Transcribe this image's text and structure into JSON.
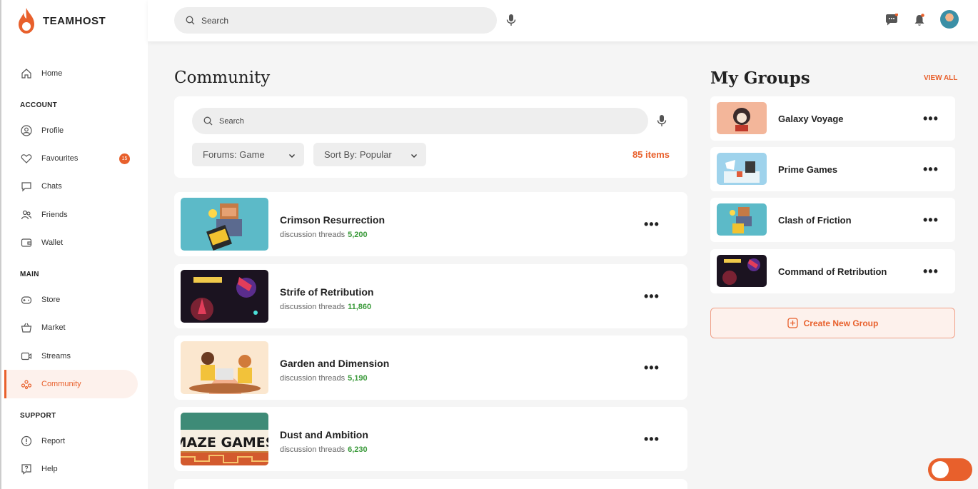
{
  "brand": {
    "name": "TEAMHOST",
    "accent": "#e8602c"
  },
  "search": {
    "placeholder": "Search"
  },
  "sidebar": {
    "home": "Home",
    "sections": {
      "account": "ACCOUNT",
      "main": "MAIN",
      "support": "SUPPORT"
    },
    "account_items": [
      {
        "label": "Profile",
        "icon": "user-icon"
      },
      {
        "label": "Favourites",
        "icon": "heart-icon",
        "badge": "15"
      },
      {
        "label": "Chats",
        "icon": "chat-icon"
      },
      {
        "label": "Friends",
        "icon": "friends-icon"
      },
      {
        "label": "Wallet",
        "icon": "wallet-icon"
      }
    ],
    "main_items": [
      {
        "label": "Store",
        "icon": "gamepad-icon"
      },
      {
        "label": "Market",
        "icon": "basket-icon"
      },
      {
        "label": "Streams",
        "icon": "video-icon"
      },
      {
        "label": "Community",
        "icon": "community-icon",
        "active": true
      }
    ],
    "support_items": [
      {
        "label": "Report",
        "icon": "alert-icon"
      },
      {
        "label": "Help",
        "icon": "help-icon"
      }
    ]
  },
  "community": {
    "title": "Community",
    "search_placeholder": "Search",
    "forum_filter": "Forums: Game",
    "sort_filter": "Sort By: Popular",
    "items_count": "85 items",
    "meta_label": "discussion threads",
    "forums": [
      {
        "name": "Crimson Resurrection",
        "threads": "5,200"
      },
      {
        "name": "Strife of Retribution",
        "threads": "11,860"
      },
      {
        "name": "Garden and Dimension",
        "threads": "5,190"
      },
      {
        "name": "Dust and Ambition",
        "threads": "6,230"
      }
    ]
  },
  "groups": {
    "title": "My Groups",
    "view_all": "VIEW ALL",
    "items": [
      {
        "name": "Galaxy Voyage"
      },
      {
        "name": "Prime Games"
      },
      {
        "name": "Clash of Friction"
      },
      {
        "name": "Command of Retribution"
      }
    ],
    "create_label": "Create New Group"
  }
}
